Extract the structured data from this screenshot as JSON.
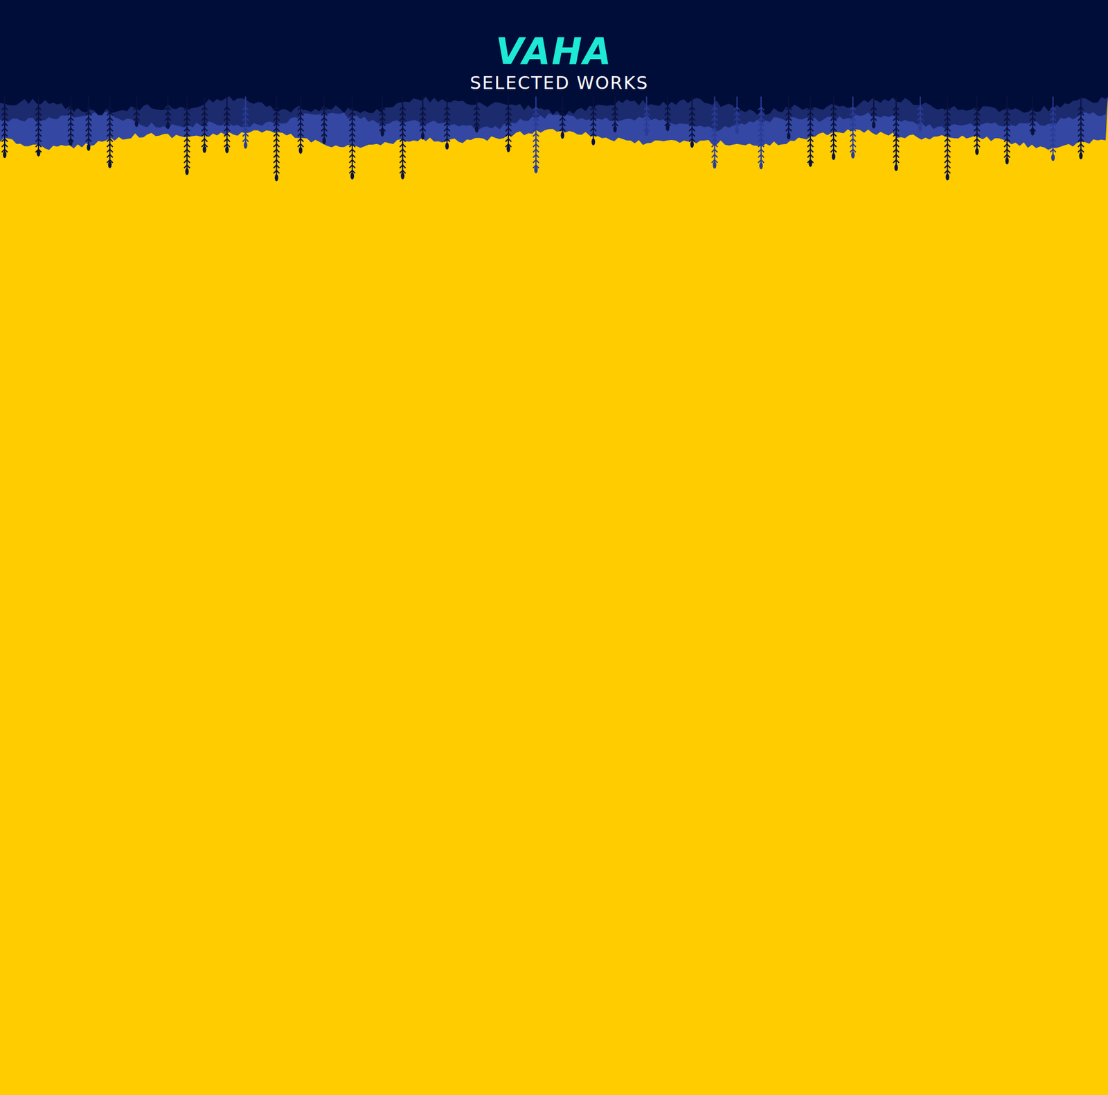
{
  "header": {
    "title": "VAHA",
    "subtitle": "SELECTED WORKS"
  }
}
